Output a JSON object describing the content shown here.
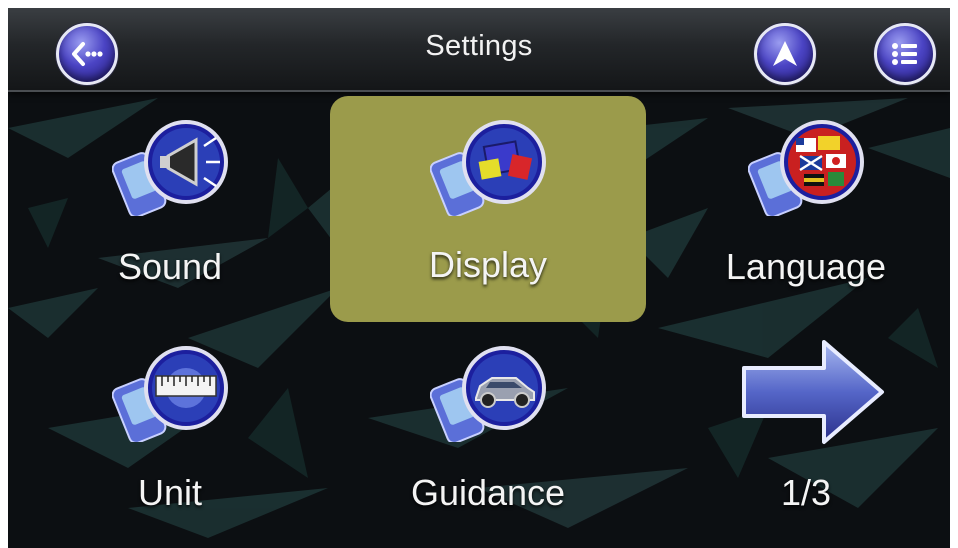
{
  "header": {
    "title": "Settings",
    "back_icon": "back-icon",
    "navigate_icon": "navigation-arrow-icon",
    "menu_icon": "menu-list-icon"
  },
  "menu": {
    "items": [
      {
        "label": "Sound",
        "icon": "sound-speaker-icon",
        "selected": false
      },
      {
        "label": "Display",
        "icon": "display-colors-icon",
        "selected": true
      },
      {
        "label": "Language",
        "icon": "language-flags-icon",
        "selected": false
      },
      {
        "label": "Unit",
        "icon": "unit-ruler-icon",
        "selected": false
      },
      {
        "label": "Guidance",
        "icon": "guidance-car-icon",
        "selected": false
      }
    ],
    "next_page": {
      "icon": "next-page-arrow-icon",
      "label": "1/3"
    }
  },
  "colors": {
    "selection": "#9b9b4b",
    "button_blue": "#4b44c4",
    "background": "#0c0f12"
  }
}
